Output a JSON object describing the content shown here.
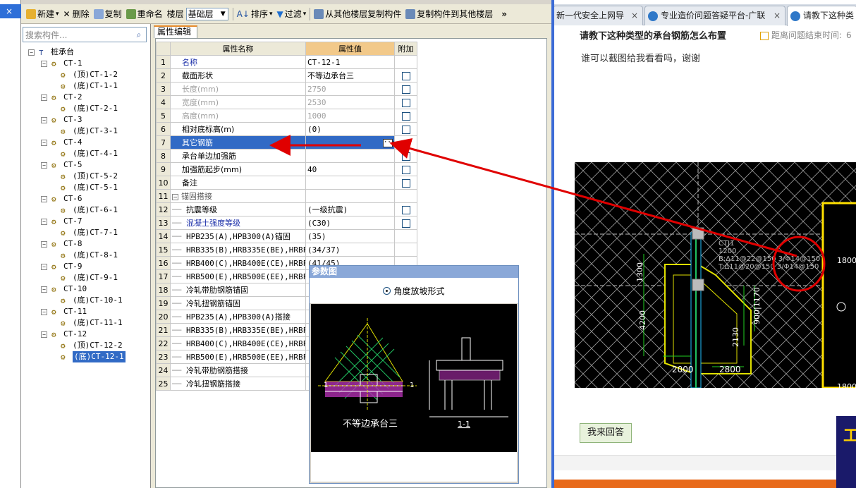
{
  "toolbar": {
    "new": "新建",
    "delete": "删除",
    "copy": "复制",
    "rename": "重命名",
    "floor_label": "楼层",
    "floor_value": "基础层",
    "sort": "排序",
    "filter": "过滤",
    "copy_from": "从其他楼层复制构件",
    "copy_to": "复制构件到其他楼层",
    "more": "»"
  },
  "left_strip": {
    "close": "×"
  },
  "tree": {
    "search_placeholder": "搜索构件...",
    "root": "桩承台",
    "items": [
      {
        "label": "CT-1",
        "children": [
          "(顶)CT-1-2",
          "(底)CT-1-1"
        ]
      },
      {
        "label": "CT-2",
        "children": [
          "(底)CT-2-1"
        ]
      },
      {
        "label": "CT-3",
        "children": [
          "(底)CT-3-1"
        ]
      },
      {
        "label": "CT-4",
        "children": [
          "(底)CT-4-1"
        ]
      },
      {
        "label": "CT-5",
        "children": [
          "(顶)CT-5-2",
          "(底)CT-5-1"
        ]
      },
      {
        "label": "CT-6",
        "children": [
          "(底)CT-6-1"
        ]
      },
      {
        "label": "CT-7",
        "children": [
          "(底)CT-7-1"
        ]
      },
      {
        "label": "CT-8",
        "children": [
          "(底)CT-8-1"
        ]
      },
      {
        "label": "CT-9",
        "children": [
          "(底)CT-9-1"
        ]
      },
      {
        "label": "CT-10",
        "children": [
          "(底)CT-10-1"
        ]
      },
      {
        "label": "CT-11",
        "children": [
          "(底)CT-11-1"
        ]
      },
      {
        "label": "CT-12",
        "children": [
          "(顶)CT-12-2",
          "(底)CT-12-1"
        ]
      }
    ]
  },
  "props": {
    "tab": "属性编辑",
    "col_name": "属性名称",
    "col_value": "属性值",
    "col_extra": "附加",
    "rows": [
      {
        "i": "1",
        "name": "名称",
        "value": "CT-12-1",
        "cb": false,
        "style": "blue"
      },
      {
        "i": "2",
        "name": "截面形状",
        "value": "不等边承台三",
        "cb": true,
        "style": ""
      },
      {
        "i": "3",
        "name": "长度(mm)",
        "value": "2750",
        "cb": true,
        "style": "gray"
      },
      {
        "i": "4",
        "name": "宽度(mm)",
        "value": "2530",
        "cb": true,
        "style": "gray"
      },
      {
        "i": "5",
        "name": "高度(mm)",
        "value": "1000",
        "cb": true,
        "style": "gray"
      },
      {
        "i": "6",
        "name": "相对底标高(m)",
        "value": "(0)",
        "cb": true,
        "style": ""
      },
      {
        "i": "7",
        "name": "其它钢筋",
        "value": "",
        "cb": false,
        "style": "sel"
      },
      {
        "i": "8",
        "name": "承台单边加强筋",
        "value": "",
        "cb": true,
        "style": ""
      },
      {
        "i": "9",
        "name": "加强筋起步(mm)",
        "value": "40",
        "cb": true,
        "style": ""
      },
      {
        "i": "10",
        "name": "备注",
        "value": "",
        "cb": true,
        "style": ""
      },
      {
        "i": "11",
        "name": "锚固搭接",
        "value": "",
        "cb": false,
        "style": "group"
      },
      {
        "i": "12",
        "name": "抗震等级",
        "value": "(一级抗震)",
        "cb": true,
        "style": "child"
      },
      {
        "i": "13",
        "name": "混凝土强度等级",
        "value": "(C30)",
        "cb": true,
        "style": "childblue"
      },
      {
        "i": "14",
        "name": "HPB235(A),HPB300(A)锚固",
        "value": "(35)",
        "cb": false,
        "style": "child"
      },
      {
        "i": "15",
        "name": "HRB335(B),HRB335E(BE),HRBF",
        "value": "(34/37)",
        "cb": false,
        "style": "child"
      },
      {
        "i": "16",
        "name": "HRB400(C),HRB400E(CE),HRBF",
        "value": "(41/45)",
        "cb": false,
        "style": "child"
      },
      {
        "i": "17",
        "name": "HRB500(E),HRB500E(EE),HRBF",
        "value": "",
        "cb": false,
        "style": "child"
      },
      {
        "i": "18",
        "name": "冷轧带肋钢筋锚固",
        "value": "",
        "cb": false,
        "style": "child"
      },
      {
        "i": "19",
        "name": "冷轧扭钢筋锚固",
        "value": "",
        "cb": false,
        "style": "child"
      },
      {
        "i": "20",
        "name": "HPB235(A),HPB300(A)搭接",
        "value": "",
        "cb": false,
        "style": "child"
      },
      {
        "i": "21",
        "name": "HRB335(B),HRB335E(BE),HRBF",
        "value": "",
        "cb": false,
        "style": "child"
      },
      {
        "i": "22",
        "name": "HRB400(C),HRB400E(CE),HRBF",
        "value": "",
        "cb": false,
        "style": "child"
      },
      {
        "i": "23",
        "name": "HRB500(E),HRB500E(EE),HRBF",
        "value": "",
        "cb": false,
        "style": "child"
      },
      {
        "i": "24",
        "name": "冷轧带肋钢筋搭接",
        "value": "",
        "cb": false,
        "style": "child"
      },
      {
        "i": "25",
        "name": "冷轧扭钢筋搭接",
        "value": "",
        "cb": false,
        "style": "child"
      }
    ],
    "ellipsis": "···"
  },
  "ref": {
    "title": "参数图",
    "option": "角度放坡形式",
    "caption": "不等边承台三",
    "section": "1-1",
    "mark": "1"
  },
  "browser": {
    "tabs": [
      {
        "label": "新一代安全上网导",
        "icon": false
      },
      {
        "label": "专业造价问题答疑平台-广联",
        "icon": true
      },
      {
        "label": "请教下这种类",
        "icon": true
      }
    ],
    "question_title": "请教下这种类型的承台钢筋怎么布置",
    "time_label": "距离问题结束时间:",
    "time_value": "6",
    "answer_text": "谁可以截图给我看看吗，谢谢",
    "answer_button": "我来回答",
    "ad_text": "工"
  },
  "cad": {
    "label1": "CTJ1",
    "label2": "1200",
    "label3": "B:Δ11@22@150 3/Φ14@150",
    "label4": "T:Δ11@20@150 3/Φ14@150",
    "dims": [
      "1800",
      "1300",
      "4200",
      "2130",
      "900|1170",
      "2000",
      "2800",
      "1800"
    ]
  },
  "colors": {
    "accent": "#316ac5",
    "arrow": "#e00000",
    "tab_orange": "#e68b2c",
    "header_val": "#f2c98a"
  }
}
